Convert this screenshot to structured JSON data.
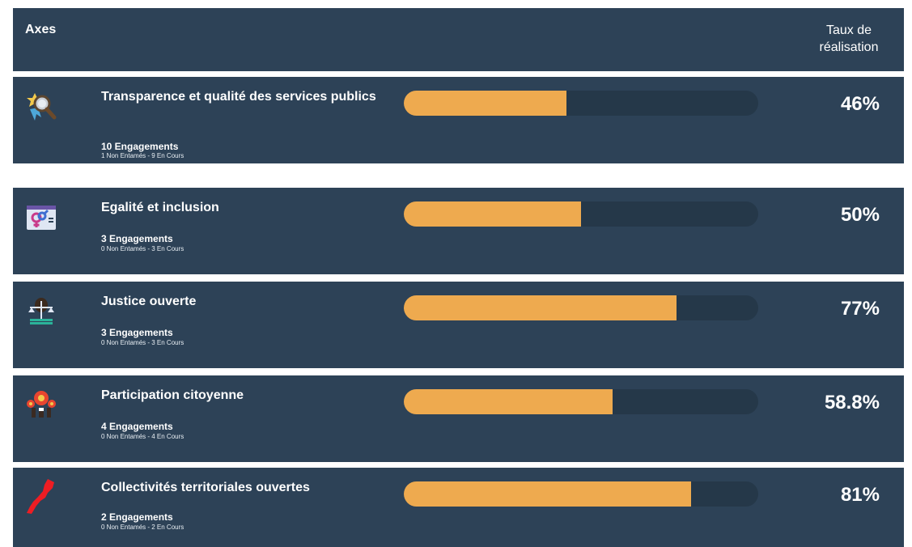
{
  "header": {
    "axes_label": "Axes",
    "taux_label_1": "Taux de",
    "taux_label_2": "réalisation"
  },
  "rows": [
    {
      "title": "Transparence et qualité des services publics",
      "engagements": "10 Engagements",
      "status": "1 Non Entamés - 9 En Cours",
      "percent_label": "46%",
      "progress": 0.46,
      "icon": "magnifier-icon"
    },
    {
      "title": "Egalité et inclusion",
      "engagements": "3 Engagements",
      "status": "0 Non Entamés - 3 En Cours",
      "percent_label": "50%",
      "progress": 0.5,
      "icon": "gender-equality-icon"
    },
    {
      "title": "Justice ouverte",
      "engagements": "3 Engagements",
      "status": "0 Non Entamés - 3 En Cours",
      "percent_label": "77%",
      "progress": 0.77,
      "icon": "justice-scales-icon"
    },
    {
      "title": "Participation citoyenne",
      "engagements": "4 Engagements",
      "status": "0 Non Entamés - 4 En Cours",
      "percent_label": "58.8%",
      "progress": 0.588,
      "icon": "citizens-icon"
    },
    {
      "title": "Collectivités territoriales ouvertes",
      "engagements": "2 Engagements",
      "status": "0 Non Entamés - 2 En Cours",
      "percent_label": "81%",
      "progress": 0.81,
      "icon": "map-icon"
    }
  ],
  "colors": {
    "background": "#2d4257",
    "bar_track": "#253849",
    "bar_fill": "#eeaa4f",
    "text": "#ffffff"
  }
}
